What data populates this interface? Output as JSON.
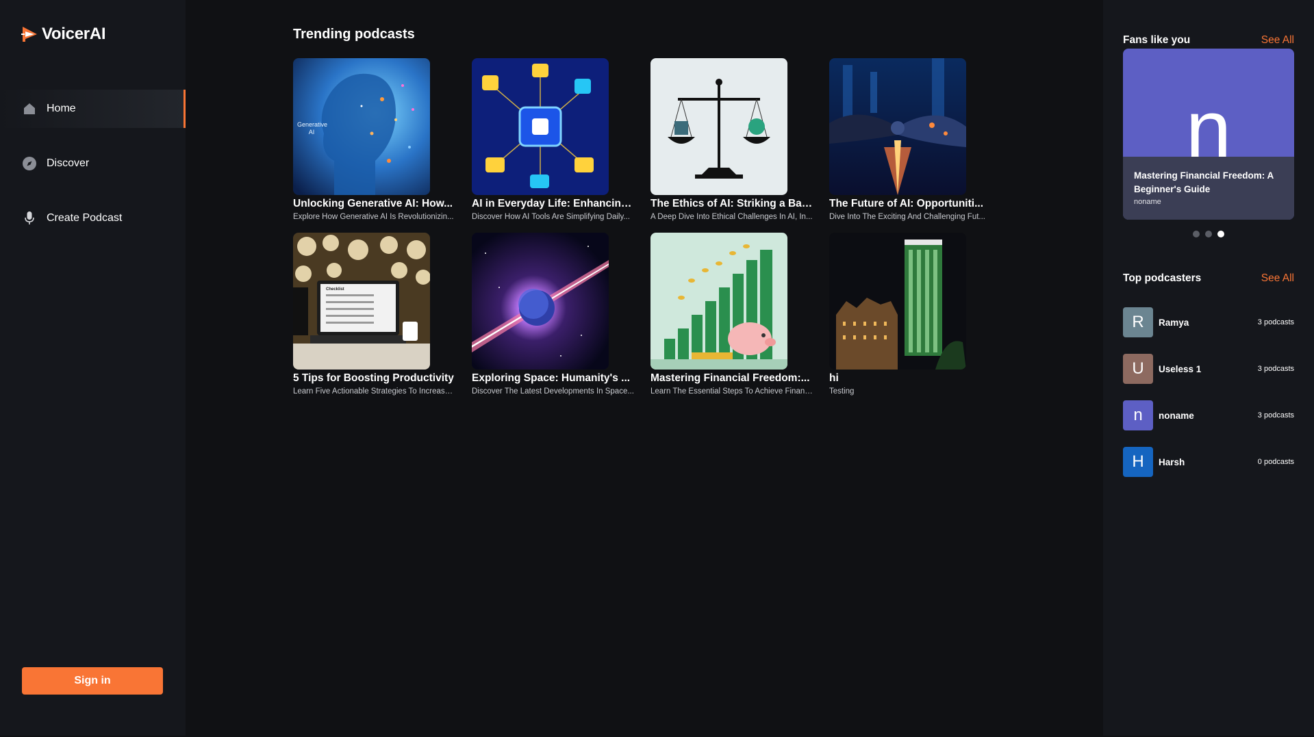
{
  "app": {
    "name": "VoicerAI"
  },
  "sidebar": {
    "items": [
      {
        "label": "Home",
        "icon": "home-icon",
        "active": true
      },
      {
        "label": "Discover",
        "icon": "compass-icon",
        "active": false
      },
      {
        "label": "Create Podcast",
        "icon": "microphone-icon",
        "active": false
      }
    ],
    "signin_label": "Sign in"
  },
  "main": {
    "section_title": "Trending podcasts",
    "podcasts": [
      {
        "title": "Unlocking Generative AI: How...",
        "description": "Explore How Generative AI Is Revolutionizin...",
        "thumb_text": "Generative AI"
      },
      {
        "title": "AI in Everyday Life: Enhancing...",
        "description": "Discover How AI Tools Are Simplifying Daily..."
      },
      {
        "title": "The Ethics of AI: Striking a Bal...",
        "description": "A Deep Dive Into Ethical Challenges In AI, In..."
      },
      {
        "title": "The Future of AI: Opportuniti...",
        "description": "Dive Into The Exciting And Challenging Fut..."
      },
      {
        "title": "5 Tips for Boosting Productivity",
        "description": "Learn Five Actionable Strategies To Increase...",
        "thumb_text": "Checklist"
      },
      {
        "title": "Exploring Space: Humanity's ...",
        "description": "Discover The Latest Developments In Space..."
      },
      {
        "title": "Mastering Financial Freedom:...",
        "description": "Learn The Essential Steps To Achieve Financi..."
      },
      {
        "title": "hi",
        "description": "Testing"
      }
    ]
  },
  "right": {
    "fans_title": "Fans like you",
    "see_all": "See All",
    "fan_card": {
      "letter": "n",
      "title": "Mastering Financial Freedom: A Beginner's Guide",
      "author": "noname"
    },
    "carousel_active_index": 2,
    "top_title": "Top podcasters",
    "podcasters": [
      {
        "initial": "R",
        "name": "Ramya",
        "count": "3 podcasts",
        "color": "#6b8591"
      },
      {
        "initial": "U",
        "name": "Useless 1",
        "count": "3 podcasts",
        "color": "#8d6a60"
      },
      {
        "initial": "n",
        "name": "noname",
        "count": "3 podcasts",
        "color": "#5d5fc4"
      },
      {
        "initial": "H",
        "name": "Harsh",
        "count": "0 podcasts",
        "color": "#1565c0"
      }
    ]
  },
  "colors": {
    "accent": "#f97535",
    "background": "#101114",
    "panel": "#15171c"
  }
}
